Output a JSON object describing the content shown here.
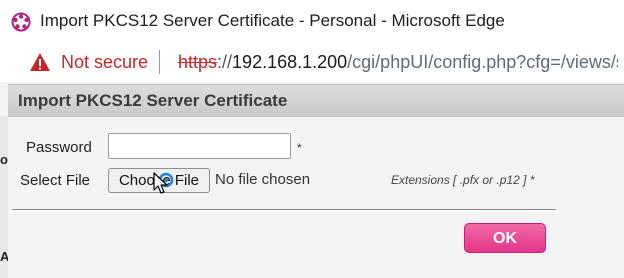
{
  "window": {
    "title": "Import PKCS12 Server Certificate - Personal - Microsoft Edge",
    "icon": "edge-logo-icon"
  },
  "addressbar": {
    "security_label": "Not secure",
    "security_icon": "warning-icon",
    "url_scheme": "https",
    "url_separator": "://",
    "url_host": "192.168.1.200",
    "url_path": "/cgi/phpUI/config.php?cfg=/views/s"
  },
  "dialog": {
    "title": "Import PKCS12 Server Certificate",
    "password_label": "Password",
    "password_value": "",
    "password_required": "*",
    "select_file_label": "Select File",
    "choose_file_label": "Choose File",
    "no_file_text": "No file chosen",
    "extensions_note": "Extensions [ .pfx or .p12 ] *",
    "ok_label": "OK"
  },
  "background_page": {
    "fragments": [
      "o",
      "A"
    ]
  },
  "colors": {
    "not_secure": "#c5282a",
    "ok_button": "#e63589",
    "dialog_header": "#d0d0d0"
  }
}
